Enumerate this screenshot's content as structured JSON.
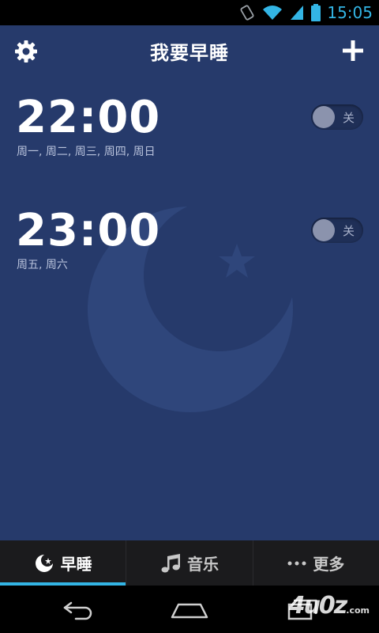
{
  "status_bar": {
    "time": "15:05",
    "icons": [
      "vibrate-icon",
      "wifi-icon",
      "signal-icon",
      "battery-icon"
    ]
  },
  "header": {
    "title": "我要早睡",
    "left_icon": "gear-icon",
    "right_icon": "plus-icon"
  },
  "alarms": [
    {
      "time": "22:00",
      "days": "周一, 周二, 周三, 周四, 周日",
      "toggle_label": "关",
      "enabled": false
    },
    {
      "time": "23:00",
      "days": "周五, 周六",
      "toggle_label": "关",
      "enabled": false
    }
  ],
  "tabs": [
    {
      "label": "早睡",
      "icon": "moon-icon",
      "active": true
    },
    {
      "label": "音乐",
      "icon": "music-note-icon",
      "active": false
    },
    {
      "label": "更多",
      "icon": "more-dots-icon",
      "active": false
    }
  ],
  "nav_bar": {
    "buttons": [
      "back-icon",
      "home-icon",
      "recent-apps-icon"
    ]
  },
  "watermark": {
    "text": "4u0z",
    "suffix": ".com"
  },
  "colors": {
    "background": "#263a6b",
    "accent": "#33b5e5",
    "tab_bar": "#1b1b1d"
  }
}
